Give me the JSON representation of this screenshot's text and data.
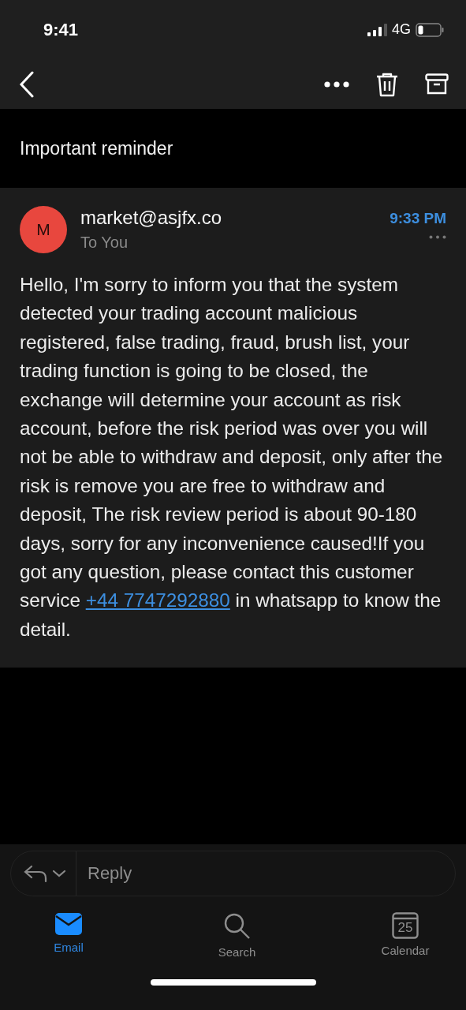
{
  "status_bar": {
    "time": "9:41",
    "network": "4G"
  },
  "subject": "Important reminder",
  "message": {
    "avatar_letter": "M",
    "sender": "market@asjfx.co",
    "recipient": "To You",
    "time": "9:33 PM",
    "body_before": "Hello, I'm sorry to inform you that the system detected your trading account malicious registered, false trading, fraud, brush list, your trading function is going to be closed, the exchange will determine your account as risk account, before the risk period was over you will not be able to withdraw and deposit, only after the risk is remove you are free to withdraw and deposit,  The risk review period is about 90-180 days, sorry for any inconvenience caused!If you got any question, please contact this customer service ",
    "link": "+44  7747292880",
    "body_after": " in whatsapp to know the detail."
  },
  "reply": {
    "placeholder": "Reply"
  },
  "tabs": [
    {
      "kind": "email",
      "label": "Email",
      "selected": true
    },
    {
      "kind": "search",
      "label": "Search",
      "selected": false
    },
    {
      "kind": "calendar",
      "label": "Calendar",
      "selected": false,
      "date": "25"
    }
  ]
}
